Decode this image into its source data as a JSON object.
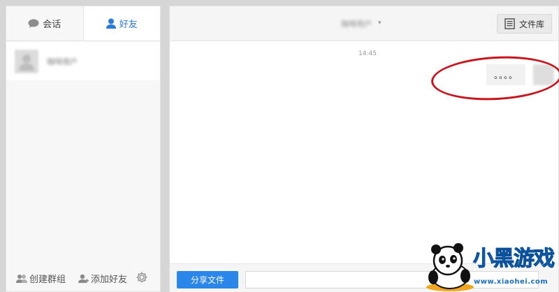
{
  "tabs": {
    "chat_label": "会话",
    "friends_label": "好友",
    "active": "friends"
  },
  "contacts": [
    {
      "name": "咖啡用户"
    }
  ],
  "left_footer": {
    "create_group_label": "创建群组",
    "add_friend_label": "添加好友"
  },
  "chat": {
    "title": "咖啡用户",
    "file_library_label": "文件库",
    "timestamp": "14:45",
    "message_text": "。。。。"
  },
  "bottom": {
    "share_file_label": "分享文件",
    "input_value": "",
    "input_placeholder": ""
  },
  "watermark": {
    "brand": "小黑游戏",
    "url": "www.xiaohei.com"
  },
  "colors": {
    "accent": "#2a86e8",
    "active_tab_text": "#2a7ad8",
    "annotation": "#c8141c"
  },
  "icons": {
    "chat_tab": "chat-bubble-icon",
    "friends_tab": "person-icon",
    "create_group": "group-icon",
    "add_friend": "add-person-icon",
    "settings": "gear-icon",
    "file_library": "document-icon"
  }
}
